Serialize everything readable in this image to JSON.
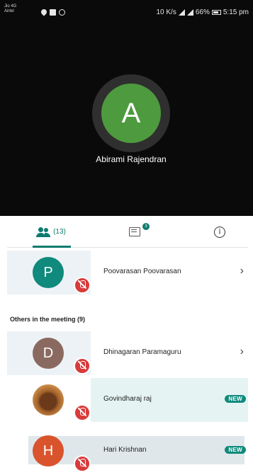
{
  "status_bar": {
    "carrier_line1": "Jio 4G",
    "carrier_line2": "Airtel",
    "speed": "10 K/s",
    "battery": "66%",
    "time": "5:15 pm"
  },
  "speaker": {
    "initial": "A",
    "name": "Abirami Rajendran",
    "avatar_color": "#4e9a3e"
  },
  "tabs": {
    "people_count": "(13)",
    "chat_badge": "3",
    "info_symbol": "i"
  },
  "participants_top": [
    {
      "initial": "P",
      "name": "Poovarasan Poovarasan",
      "color": "#0f8a7c",
      "muted": true
    }
  ],
  "others_section_title": "Others in the meeting (9)",
  "participants_others": [
    {
      "initial": "D",
      "name": "Dhinagaran Paramaguru",
      "color": "#8a6a60",
      "muted": true,
      "badge": ""
    },
    {
      "initial": "",
      "name": "Govindharaj raj",
      "color": "#a0602a",
      "muted": true,
      "badge": "NEW"
    },
    {
      "initial": "H",
      "name": "Hari Krishnan",
      "color": "#d9532c",
      "muted": true,
      "badge": "NEW"
    }
  ],
  "colors": {
    "accent": "#0c7b6e",
    "mute_red": "#d93a3a",
    "dark_bg": "#0a0a0a"
  }
}
